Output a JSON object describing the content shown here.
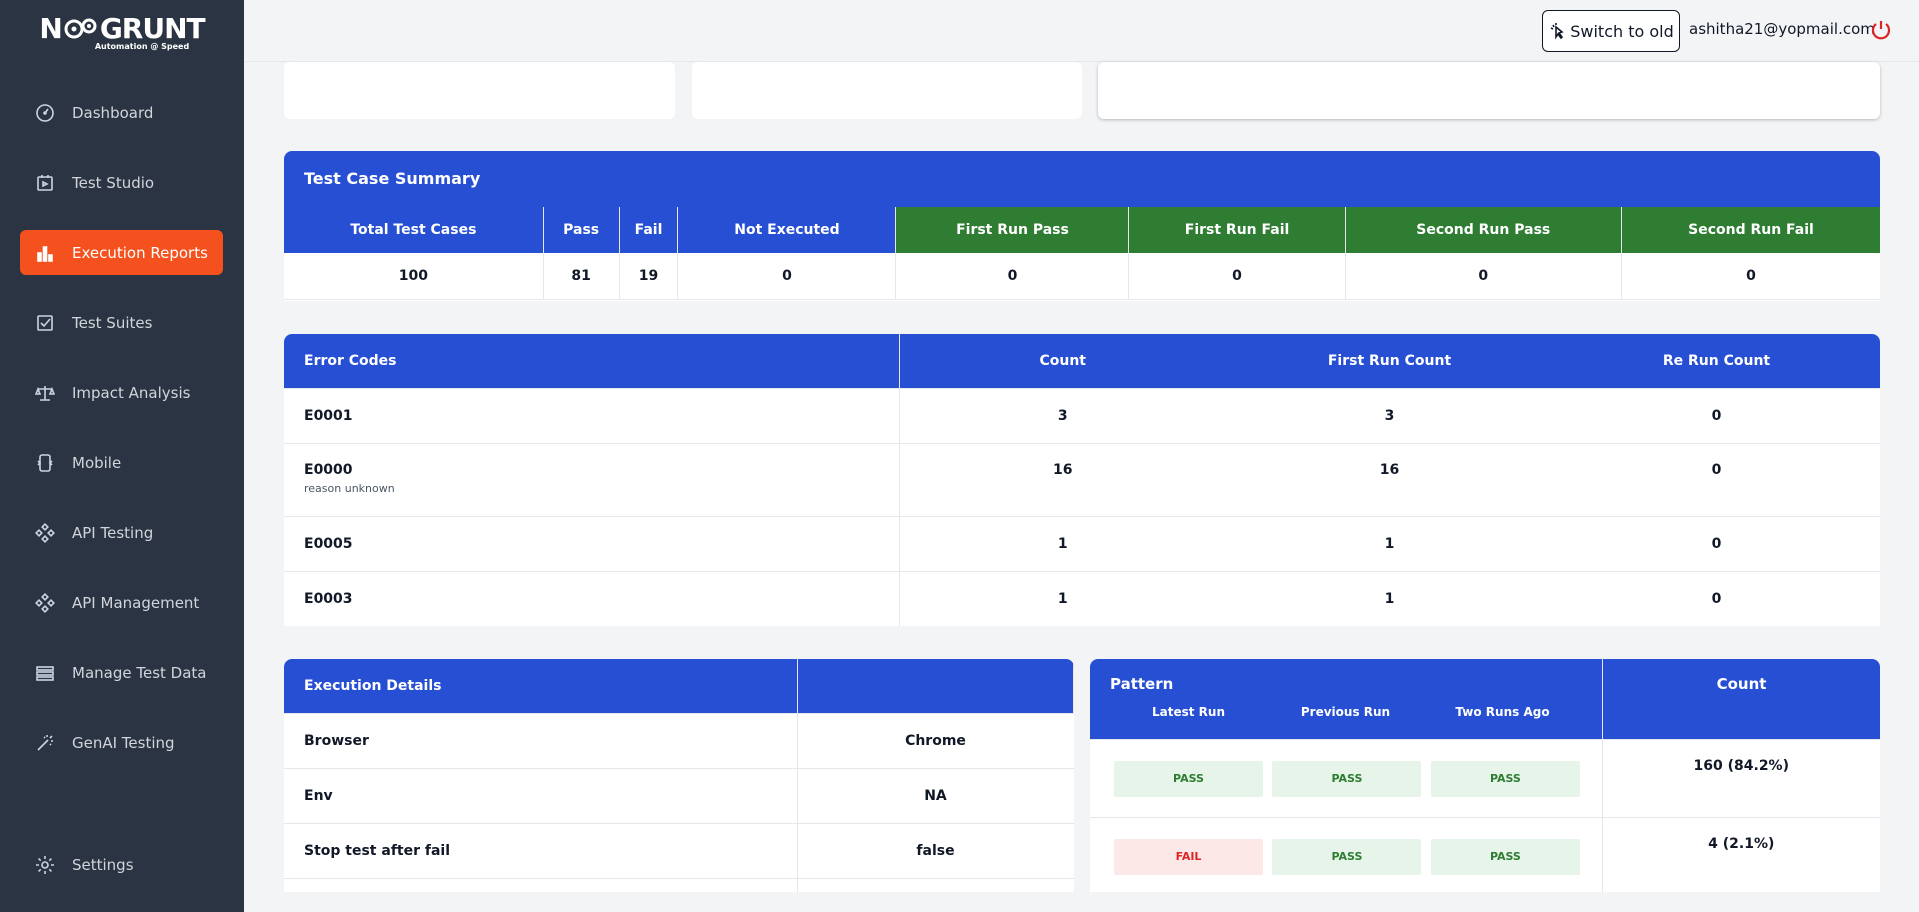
{
  "app": {
    "brand": "N GRUNT",
    "tagline": "Automation @ Speed"
  },
  "sidebar": {
    "items": [
      {
        "label": "Dashboard",
        "icon": "speedometer-icon"
      },
      {
        "label": "Test Studio",
        "icon": "studio-icon"
      },
      {
        "label": "Execution Reports",
        "icon": "bar-chart-icon",
        "active": true
      },
      {
        "label": "Test Suites",
        "icon": "checklist-icon"
      },
      {
        "label": "Impact Analysis",
        "icon": "scale-icon"
      },
      {
        "label": "Mobile",
        "icon": "mobile-icon"
      },
      {
        "label": "API Testing",
        "icon": "api-icon"
      },
      {
        "label": "API Management",
        "icon": "api-icon"
      },
      {
        "label": "Manage Test Data",
        "icon": "database-icon"
      },
      {
        "label": "GenAI Testing",
        "icon": "magic-wand-icon"
      }
    ],
    "settings_label": "Settings"
  },
  "topbar": {
    "switch_label": "Switch to old",
    "user_email": "ashitha21@yopmail.com"
  },
  "summary": {
    "title": "Test Case Summary",
    "headers": [
      "Total Test Cases",
      "Pass",
      "Fail",
      "Not Executed",
      "First Run Pass",
      "First Run Fail",
      "Second Run Pass",
      "Second Run Fail"
    ],
    "values": [
      "100",
      "81",
      "19",
      "0",
      "0",
      "0",
      "0",
      "0"
    ]
  },
  "errors": {
    "headers": [
      "Error Codes",
      "Count",
      "First Run Count",
      "Re Run Count"
    ],
    "rows": [
      {
        "code": "E0001",
        "desc": "",
        "count": "3",
        "first": "3",
        "rerun": "0"
      },
      {
        "code": "E0000",
        "desc": "reason unknown",
        "count": "16",
        "first": "16",
        "rerun": "0"
      },
      {
        "code": "E0005",
        "desc": "",
        "count": "1",
        "first": "1",
        "rerun": "0"
      },
      {
        "code": "E0003",
        "desc": "",
        "count": "1",
        "first": "1",
        "rerun": "0"
      }
    ]
  },
  "exec": {
    "title": "Execution Details",
    "rows": [
      {
        "label": "Browser",
        "value": "Chrome"
      },
      {
        "label": "Env",
        "value": "NA"
      },
      {
        "label": "Stop test after fail",
        "value": "false"
      }
    ]
  },
  "pattern": {
    "title": "Pattern",
    "count_header": "Count",
    "sub_headers": [
      "Latest Run",
      "Previous Run",
      "Two Runs Ago"
    ],
    "rows": [
      {
        "runs": [
          "PASS",
          "PASS",
          "PASS"
        ],
        "count": "160 (84.2%)"
      },
      {
        "runs": [
          "FAIL",
          "PASS",
          "PASS"
        ],
        "count": "4 (2.1%)"
      }
    ]
  },
  "colors": {
    "sidebar": "#2b3442",
    "accent": "#f4511e",
    "header_blue": "#274fd4",
    "header_green": "#2e7d32"
  }
}
